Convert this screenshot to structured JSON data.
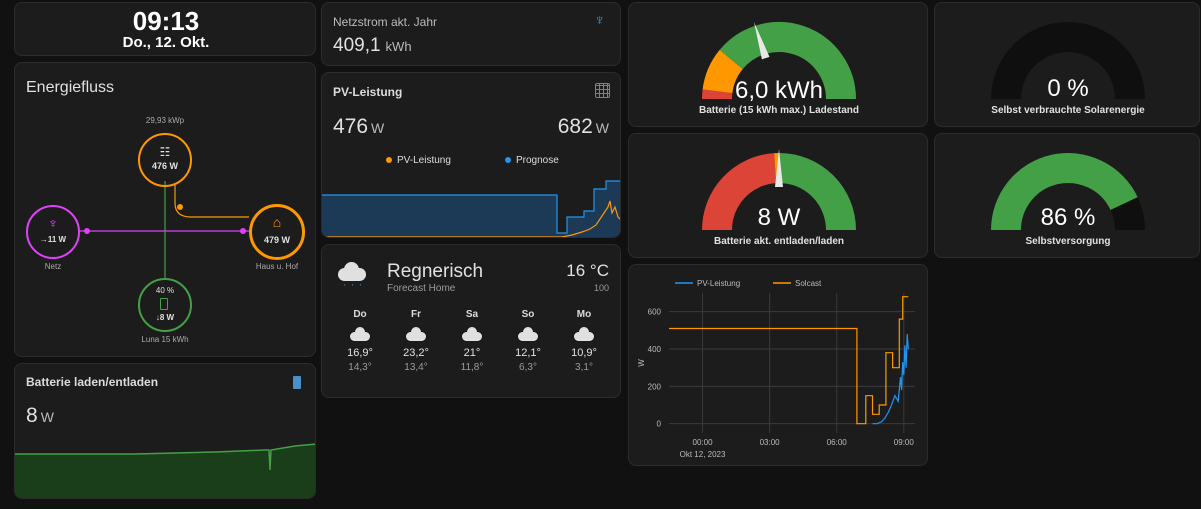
{
  "clock": {
    "time": "09:13",
    "date": "Do., 12. Okt."
  },
  "grid_card": {
    "title": "Netzstrom akt. Jahr",
    "value": "409,1",
    "unit": "kWh"
  },
  "pv_card": {
    "title": "PV-Leistung",
    "value1": "476",
    "unit1": "W",
    "value2": "682",
    "unit2": "W",
    "legend1": "PV-Leistung",
    "legend2": "Prognose",
    "color1": "#ff9800",
    "color2": "#2196f3"
  },
  "energy_flow": {
    "title": "Energiefluss",
    "solar": {
      "top_label": "29,93 kWp",
      "value": "476 W"
    },
    "grid": {
      "value": "→11 W",
      "label": "Netz"
    },
    "home": {
      "value": "479 W",
      "label": "Haus u. Hof"
    },
    "battery": {
      "percent": "40 %",
      "value": "↓8 W",
      "label": "Luna 15 kWh"
    }
  },
  "battery_card": {
    "title": "Batterie laden/entladen",
    "value": "8",
    "unit": "W"
  },
  "weather": {
    "condition": "Regnerisch",
    "source": "Forecast Home",
    "temperature": "16 °C",
    "extra": "100",
    "days": [
      {
        "day": "Do",
        "high": "16,9°",
        "low": "14,3°",
        "icon": "rain-cloud-icon"
      },
      {
        "day": "Fr",
        "high": "23,2°",
        "low": "13,4°",
        "icon": "cloud-icon"
      },
      {
        "day": "Sa",
        "high": "21°",
        "low": "11,8°",
        "icon": "rain-cloud-icon"
      },
      {
        "day": "So",
        "high": "12,1°",
        "low": "6,3°",
        "icon": "rain-cloud-icon"
      },
      {
        "day": "Mo",
        "high": "10,9°",
        "low": "3,1°",
        "icon": "cloud-icon"
      }
    ]
  },
  "gauges": {
    "battery_level": {
      "value": "6,0 kWh",
      "label": "Batterie (15 kWh max.) Ladestand",
      "fraction": 0.4
    },
    "self_consumption": {
      "value": "0 %",
      "label": "Selbst verbrauchte Solarenergie",
      "fraction": 0.0
    },
    "battery_power": {
      "value": "8 W",
      "label": "Batterie akt. entladen/laden",
      "fraction": 0.5
    },
    "self_sufficiency": {
      "value": "86 %",
      "label": "Selbstversorgung",
      "fraction": 0.86
    }
  },
  "colors": {
    "green": "#43a047",
    "orange": "#ff9800",
    "red": "#db4437",
    "blue": "#2196f3",
    "magenta": "#e040fb"
  },
  "chart_data": {
    "type": "line",
    "x_ticks": [
      "00:00",
      "03:00",
      "06:00",
      "09:00"
    ],
    "x_sublabel": "Okt 12, 2023",
    "ylabel": "W",
    "y_ticks": [
      "0",
      "200",
      "400",
      "600"
    ],
    "ylim": [
      -50,
      700
    ],
    "xlim": [
      -1.5,
      9.5
    ],
    "grid": true,
    "legend_position": "top",
    "series": [
      {
        "name": "PV-Leistung",
        "color": "#2196f3",
        "x": [
          7.6,
          7.8,
          8.0,
          8.15,
          8.3,
          8.45,
          8.6,
          8.75,
          8.85,
          8.9,
          8.95,
          9.0,
          9.05,
          9.1,
          9.15,
          9.2
        ],
        "y": [
          0,
          0,
          10,
          30,
          60,
          100,
          150,
          120,
          250,
          180,
          330,
          260,
          420,
          300,
          480,
          400
        ]
      },
      {
        "name": "Solcast",
        "color": "#ff9800",
        "x": [
          -1.5,
          6.9,
          6.9,
          7.3,
          7.3,
          7.6,
          7.6,
          7.9,
          7.9,
          8.2,
          8.2,
          8.5,
          8.5,
          8.8,
          8.8,
          8.95,
          8.95,
          9.2
        ],
        "y": [
          510,
          510,
          0,
          0,
          150,
          150,
          50,
          50,
          100,
          100,
          380,
          380,
          300,
          300,
          560,
          560,
          680,
          680
        ]
      }
    ]
  }
}
